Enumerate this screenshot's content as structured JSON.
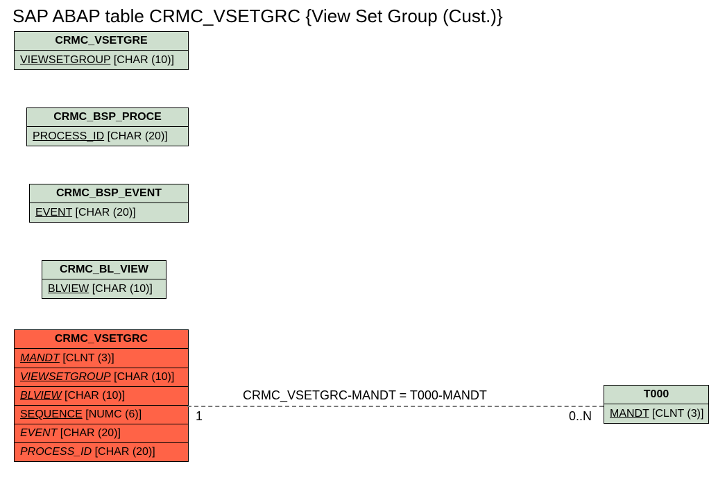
{
  "title": "SAP ABAP table CRMC_VSETGRC {View Set Group (Cust.)}",
  "entities": {
    "vsetgre": {
      "name": "CRMC_VSETGRE",
      "rows": [
        {
          "field": "VIEWSETGROUP",
          "type": "[CHAR (10)]",
          "underline": true,
          "italic": false
        }
      ]
    },
    "proce": {
      "name": "CRMC_BSP_PROCE",
      "rows": [
        {
          "field": "PROCESS_ID",
          "type": "[CHAR (20)]",
          "underline": true,
          "italic": false
        }
      ]
    },
    "event": {
      "name": "CRMC_BSP_EVENT",
      "rows": [
        {
          "field": "EVENT",
          "type": "[CHAR (20)]",
          "underline": true,
          "italic": false
        }
      ]
    },
    "blview": {
      "name": "CRMC_BL_VIEW",
      "rows": [
        {
          "field": "BLVIEW",
          "type": "[CHAR (10)]",
          "underline": true,
          "italic": false
        }
      ]
    },
    "vsetgrc": {
      "name": "CRMC_VSETGRC",
      "rows": [
        {
          "field": "MANDT",
          "type": "[CLNT (3)]",
          "underline": true,
          "italic": true
        },
        {
          "field": "VIEWSETGROUP",
          "type": "[CHAR (10)]",
          "underline": true,
          "italic": true
        },
        {
          "field": "BLVIEW",
          "type": "[CHAR (10)]",
          "underline": true,
          "italic": true
        },
        {
          "field": "SEQUENCE",
          "type": "[NUMC (6)]",
          "underline": true,
          "italic": false
        },
        {
          "field": "EVENT",
          "type": "[CHAR (20)]",
          "underline": false,
          "italic": true
        },
        {
          "field": "PROCESS_ID",
          "type": "[CHAR (20)]",
          "underline": false,
          "italic": true
        }
      ]
    },
    "t000": {
      "name": "T000",
      "rows": [
        {
          "field": "MANDT",
          "type": "[CLNT (3)]",
          "underline": true,
          "italic": false
        }
      ]
    }
  },
  "relationship": {
    "left_card": "1",
    "right_card": "0..N",
    "label": "CRMC_VSETGRC-MANDT = T000-MANDT"
  }
}
